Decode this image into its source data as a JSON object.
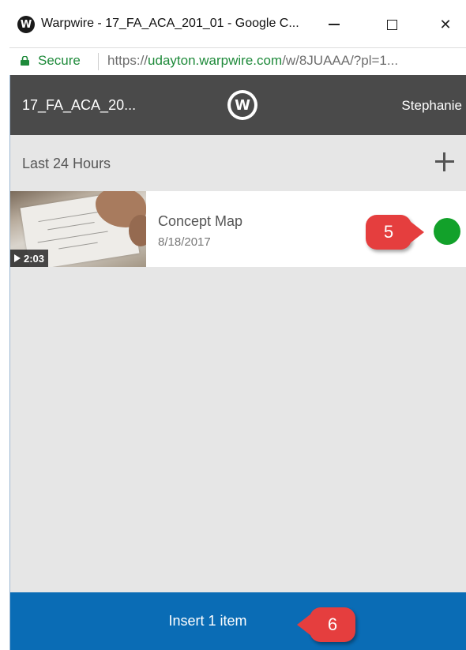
{
  "window": {
    "title": "Warpwire - 17_FA_ACA_201_01 - Google C...",
    "app_icon": "W",
    "controls": {
      "minimize": "minimize-icon",
      "maximize": "maximize-icon",
      "close": "✕"
    }
  },
  "address_bar": {
    "secure_label": "Secure",
    "url_prefix": "https://",
    "url_host": "udayton.warpwire.com",
    "url_path": "/w/8JUAAA/?pl=1..."
  },
  "header": {
    "course": "17_FA_ACA_20...",
    "logo_letter": "W",
    "user": "Stephanie"
  },
  "section": {
    "title": "Last 24 Hours",
    "add_icon": "plus-icon"
  },
  "items": [
    {
      "title": "Concept Map",
      "date": "8/18/2017",
      "duration": "2:03",
      "selected": true
    }
  ],
  "callouts": {
    "select": "5",
    "insert": "6"
  },
  "footer": {
    "insert_label": "Insert 1 item"
  },
  "colors": {
    "header_bg": "#4a4a4a",
    "footer_bg": "#0a6cb5",
    "selected": "#12a12a",
    "callout": "#e53e3e",
    "secure_green": "#1e8a3a"
  }
}
